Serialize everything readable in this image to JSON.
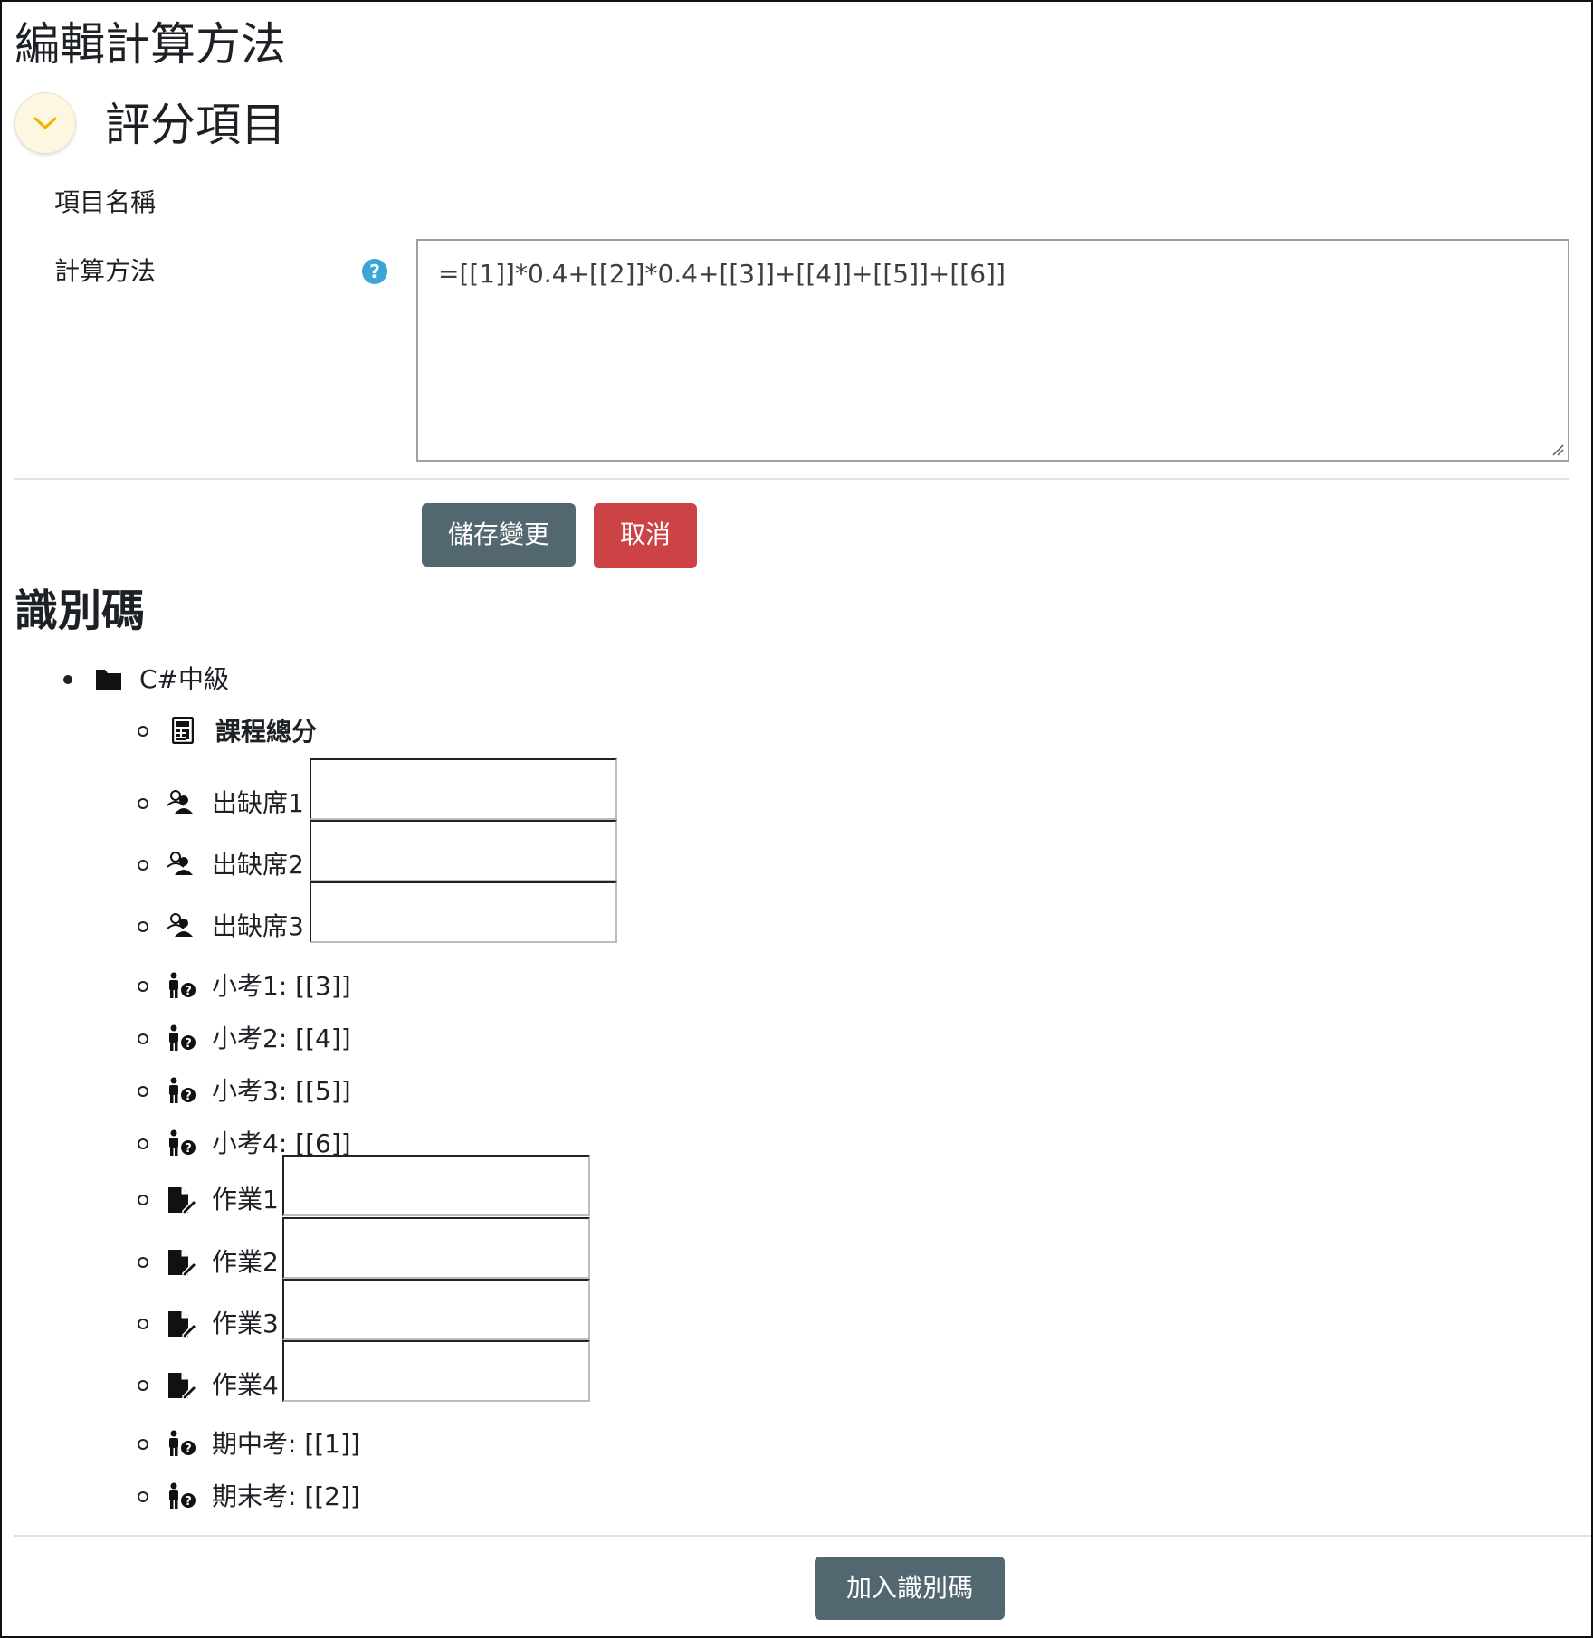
{
  "page": {
    "title": "編輯計算方法"
  },
  "section": {
    "title": "評分項目"
  },
  "form": {
    "item_name_label": "項目名稱",
    "calc_label": "計算方法",
    "calc_value": "=[[1]]*0.4+[[2]]*0.4+[[3]]+[[4]]+[[5]]+[[6]]",
    "save_label": "儲存變更",
    "cancel_label": "取消"
  },
  "id_section": {
    "title": "識別碼",
    "category": "C#中級",
    "course_total": "課程總分",
    "items": [
      {
        "label": "出缺席1",
        "icon": "attendance-icon",
        "value": ""
      },
      {
        "label": "出缺席2",
        "icon": "attendance-icon",
        "value": ""
      },
      {
        "label": "出缺席3",
        "icon": "attendance-icon",
        "value": ""
      },
      {
        "label": "小考1: [[3]]",
        "icon": "quiz-icon"
      },
      {
        "label": "小考2: [[4]]",
        "icon": "quiz-icon"
      },
      {
        "label": "小考3: [[5]]",
        "icon": "quiz-icon"
      },
      {
        "label": "小考4: [[6]]",
        "icon": "quiz-icon"
      },
      {
        "label": "作業1",
        "icon": "assignment-icon",
        "value": ""
      },
      {
        "label": "作業2",
        "icon": "assignment-icon",
        "value": ""
      },
      {
        "label": "作業3",
        "icon": "assignment-icon",
        "value": ""
      },
      {
        "label": "作業4",
        "icon": "assignment-icon",
        "value": ""
      },
      {
        "label": "期中考: [[1]]",
        "icon": "quiz-icon"
      },
      {
        "label": "期末考: [[2]]",
        "icon": "quiz-icon"
      }
    ],
    "add_label": "加入識別碼"
  },
  "colors": {
    "primary_button": "#536770",
    "danger_button": "#cc4245",
    "help_icon": "#3ba4d8",
    "chevron": "#f0b400"
  }
}
